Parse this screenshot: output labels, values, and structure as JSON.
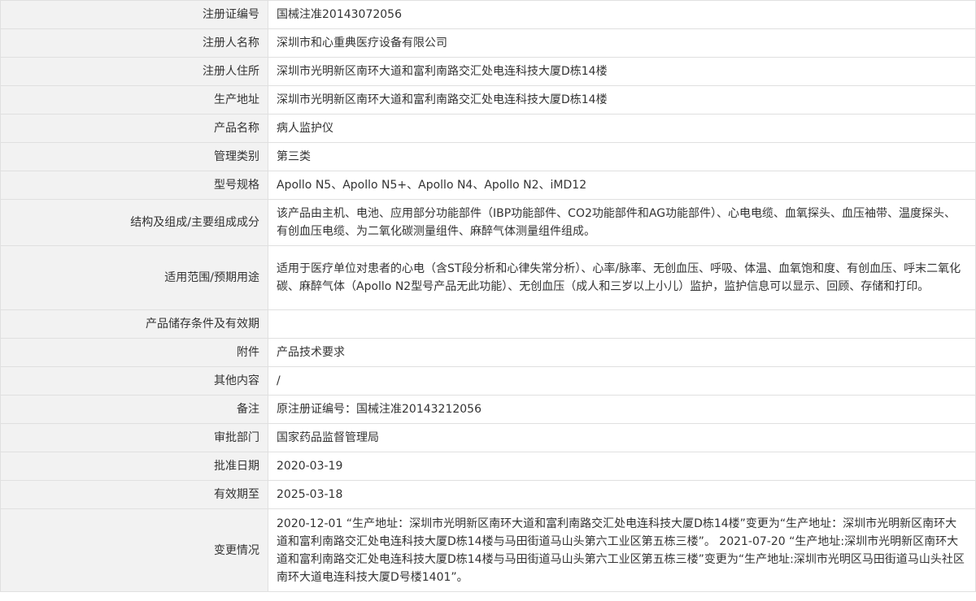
{
  "rows": [
    {
      "label": "注册证编号",
      "value": "国械注准20143072056"
    },
    {
      "label": "注册人名称",
      "value": "深圳市和心重典医疗设备有限公司"
    },
    {
      "label": "注册人住所",
      "value": "深圳市光明新区南环大道和富利南路交汇处电连科技大厦D栋14楼"
    },
    {
      "label": "生产地址",
      "value": "深圳市光明新区南环大道和富利南路交汇处电连科技大厦D栋14楼"
    },
    {
      "label": "产品名称",
      "value": "病人监护仪"
    },
    {
      "label": "管理类别",
      "value": "第三类"
    },
    {
      "label": "型号规格",
      "value": "Apollo N5、Apollo N5+、Apollo N4、Apollo N2、iMD12"
    },
    {
      "label": "结构及组成/主要组成成分",
      "value": "该产品由主机、电池、应用部分功能部件（IBP功能部件、CO2功能部件和AG功能部件）、心电电缆、血氧探头、血压袖带、温度探头、有创血压电缆、为二氧化碳测量组件、麻醉气体测量组件组成。"
    },
    {
      "label": "适用范围/预期用途",
      "value": "适用于医疗单位对患者的心电（含ST段分析和心律失常分析）、心率/脉率、无创血压、呼吸、体温、血氧饱和度、有创血压、呼末二氧化碳、麻醉气体（Apollo N2型号产品无此功能）、无创血压（成人和三岁以上小儿）监护，监护信息可以显示、回顾、存储和打印。"
    },
    {
      "label": "产品储存条件及有效期",
      "value": ""
    },
    {
      "label": "附件",
      "value": "产品技术要求"
    },
    {
      "label": "其他内容",
      "value": "/"
    },
    {
      "label": "备注",
      "value": "原注册证编号：国械注准20143212056"
    },
    {
      "label": "审批部门",
      "value": "国家药品监督管理局"
    },
    {
      "label": "批准日期",
      "value": "2020-03-19"
    },
    {
      "label": "有效期至",
      "value": "2025-03-18"
    },
    {
      "label": "变更情况",
      "value": "2020-12-01 “生产地址：深圳市光明新区南环大道和富利南路交汇处电连科技大厦D栋14楼”变更为“生产地址：深圳市光明新区南环大道和富利南路交汇处电连科技大厦D栋14楼与马田街道马山头第六工业区第五栋三楼”。 2021-07-20 “生产地址:深圳市光明新区南环大道和富利南路交汇处电连科技大厦D栋14楼与马田街道马山头第六工业区第五栋三楼”变更为“生产地址:深圳市光明区马田街道马山头社区南环大道电连科技大厦D号楼1401”。"
    }
  ]
}
